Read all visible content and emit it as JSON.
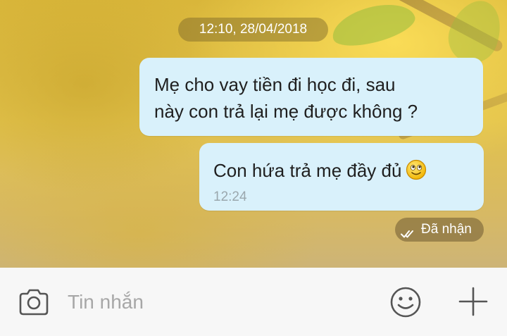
{
  "chat": {
    "time_divider": "12:10, 28/04/2018",
    "messages": [
      {
        "text": "Mẹ cho vay tiền đi học đi, sau\nnày con trả lại mẹ được không ?"
      },
      {
        "text": "Con hứa trả mẹ đầy đủ",
        "emoji": "smiling-face-emoji",
        "time": "12:24"
      }
    ],
    "status": "Đã nhận"
  },
  "composer": {
    "placeholder": "Tin nhắn",
    "camera_icon": "camera-icon",
    "emoji_icon": "smiley-icon",
    "add_icon": "plus-icon"
  },
  "colors": {
    "bubble": "#d9f1fb",
    "composer_bg": "#f7f7f7",
    "placeholder": "#a7a7a7",
    "icon": "#555555"
  }
}
